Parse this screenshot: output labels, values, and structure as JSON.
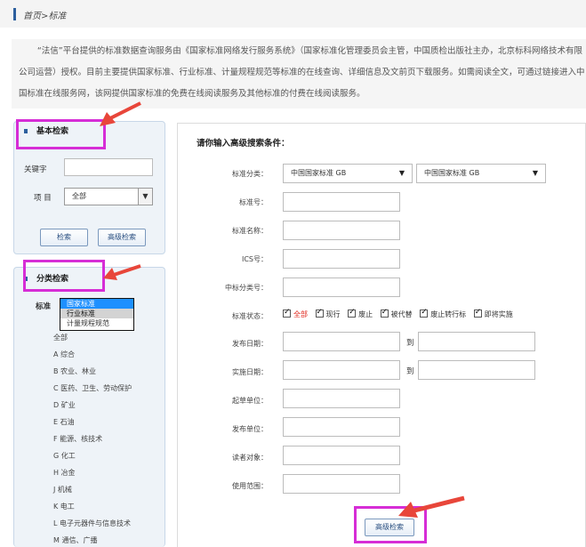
{
  "breadcrumb": {
    "home": "首页",
    "sep": ">",
    "current": "标准"
  },
  "intro": "“法信”平台提供的标准数据查询服务由《国家标准网络发行服务系统》（国家标准化管理委员会主管，中国质检出版社主办，北京标科网络技术有限公司运营）授权。目前主要提供国家标准、行业标准、计量规程规范等标准的在线查询、详细信息及文前页下载服务。如需阅读全文，可通过链接进入中国标准在线服务网，该网提供国家标准的免费在线阅读服务及其他标准的付费在线阅读服务。",
  "basic_search": {
    "title": "基本检索",
    "keyword_label": "关键字",
    "keyword_value": "",
    "item_label": "项 目",
    "item_selected": "全部",
    "search_button": "检索",
    "advanced_button": "高级检索"
  },
  "category_search": {
    "title": "分类检索",
    "standard_label": "标准",
    "dropdown_options": [
      "国家标准",
      "行业标准",
      "计量规程规范"
    ],
    "categories": [
      "全部",
      "A 综合",
      "B 农业、林业",
      "C 医药、卫生、劳动保护",
      "D 矿业",
      "E 石油",
      "F 能源、核技术",
      "G 化工",
      "H 冶金",
      "J 机械",
      "K 电工",
      "L 电子元器件与信息技术",
      "M 通信、广播"
    ]
  },
  "advanced": {
    "title": "请你输入高级搜索条件：",
    "labels": {
      "category": "标准分类：",
      "number": "标准号：",
      "name": "标准名称：",
      "ics": "ICS号：",
      "ccs": "中标分类号：",
      "status": "标准状态：",
      "publish_date": "发布日期：",
      "implement_date": "实施日期：",
      "drafter": "起草单位：",
      "publisher": "发布单位：",
      "audience": "读者对象：",
      "scope": "使用范围："
    },
    "category_select_1": "中国国家标准 GB",
    "category_select_2": "中国国家标准 GB",
    "to_label": "到",
    "statuses": [
      "全部",
      "现行",
      "废止",
      "被代替",
      "废止转行标",
      "即将实施"
    ],
    "search_button": "高级检索"
  },
  "colors": {
    "annotation": "#d62dd6",
    "arrow": "#e8463a",
    "accent": "#2d5f9e"
  }
}
